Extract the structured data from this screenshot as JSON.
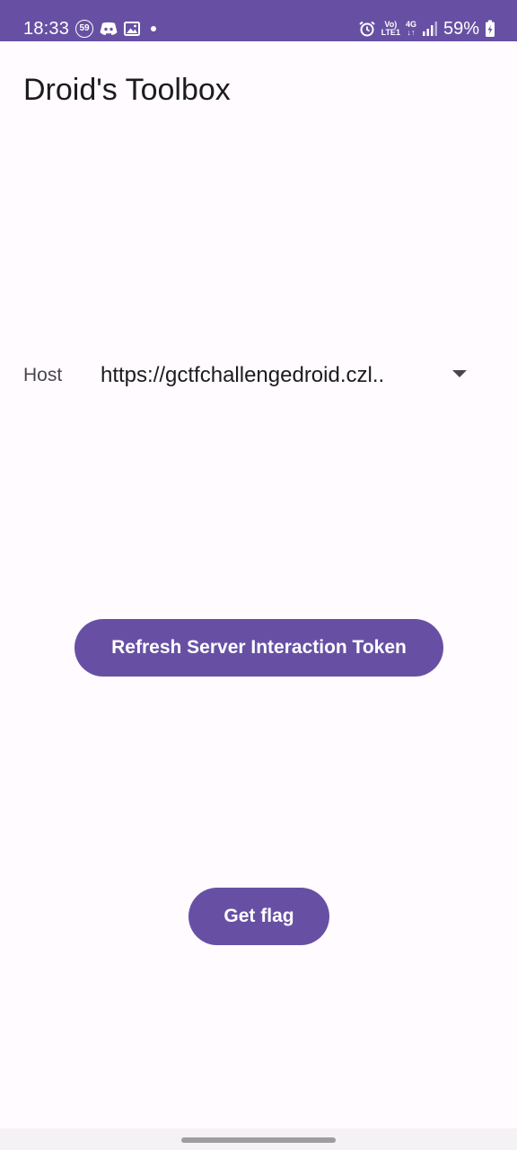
{
  "status_bar": {
    "time": "18:33",
    "notification_badge": "59",
    "network_top": "Vo)",
    "network_bottom": "LTE1",
    "network_type": "4G",
    "battery_percent": "59%",
    "icons": [
      "notification-count-icon",
      "discord-icon",
      "gallery-icon",
      "more-dot-icon",
      "alarm-icon",
      "volte-icon",
      "data-arrows-icon",
      "signal-icon",
      "battery-charging-icon"
    ],
    "background_color": "#6750A4"
  },
  "app": {
    "title": "Droid's Toolbox",
    "accent_color": "#6750A4",
    "background_color": "#FFFBFE"
  },
  "host": {
    "label": "Host",
    "selected_value": "https://gctfchallengedroid.czl..",
    "dropdown_icon": "dropdown-arrow-icon"
  },
  "buttons": {
    "refresh_label": "Refresh Server Interaction Token",
    "get_flag_label": "Get flag"
  }
}
